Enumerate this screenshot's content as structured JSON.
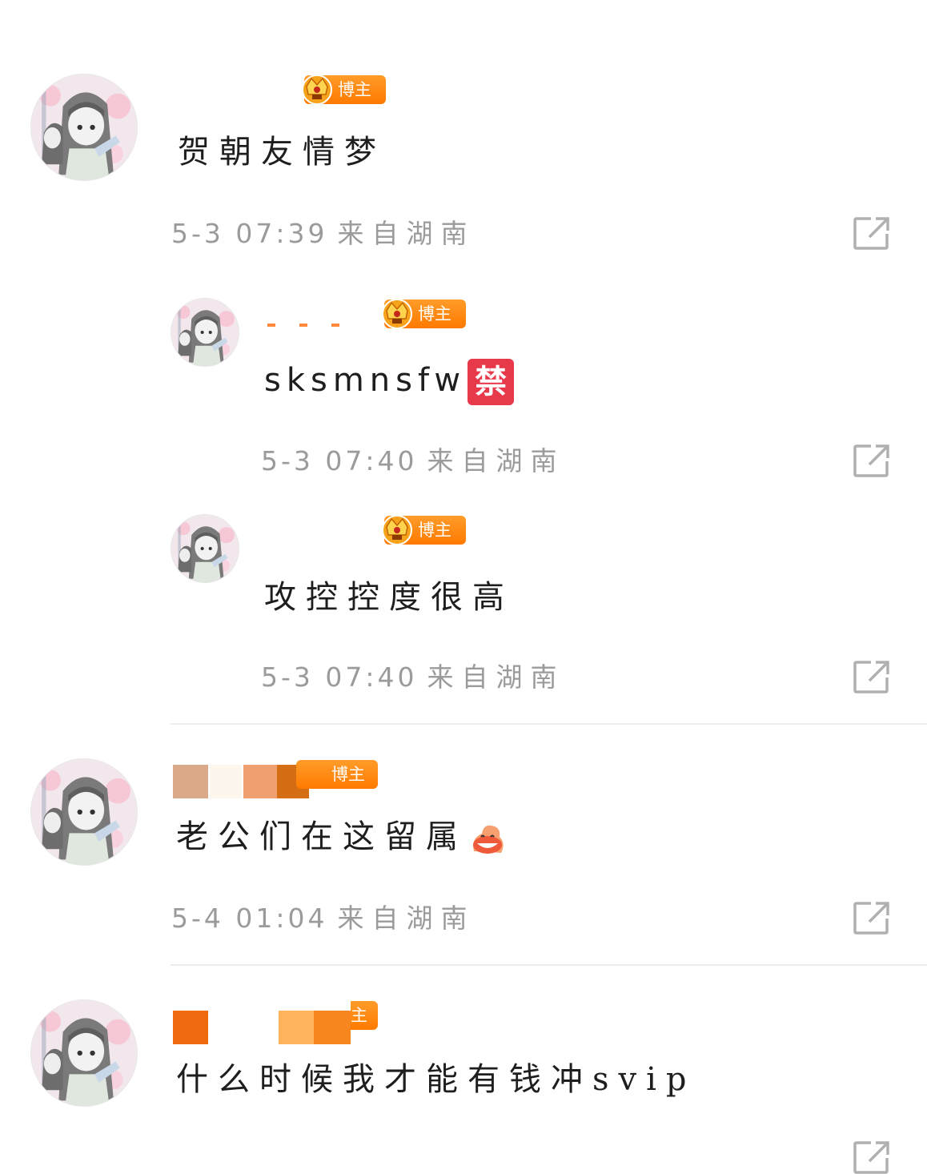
{
  "badge_label": "博主",
  "comments": [
    {
      "text": "贺朝友情梦",
      "time": "5-3 07:39",
      "location": "来自湖南"
    },
    {
      "text": "sksmnsfw",
      "emoji": "禁",
      "time": "5-3 07:40",
      "location": "来自湖南"
    },
    {
      "text": "攻控控度很高",
      "time": "5-3 07:40",
      "location": "来自湖南"
    },
    {
      "text": "老公们在这留属",
      "emoji_icon": "grinning-bun-emoji",
      "time": "5-4 01:04",
      "location": "来自湖南"
    },
    {
      "text": "什么时候我才能有钱冲svip",
      "badge_partial": "主"
    }
  ],
  "colors": {
    "badge": "#ff8a10",
    "meta_text": "#9b9b9b",
    "ban_badge": "#e8394b"
  },
  "icons": {
    "share": "share-icon",
    "crown": "crown-icon"
  }
}
